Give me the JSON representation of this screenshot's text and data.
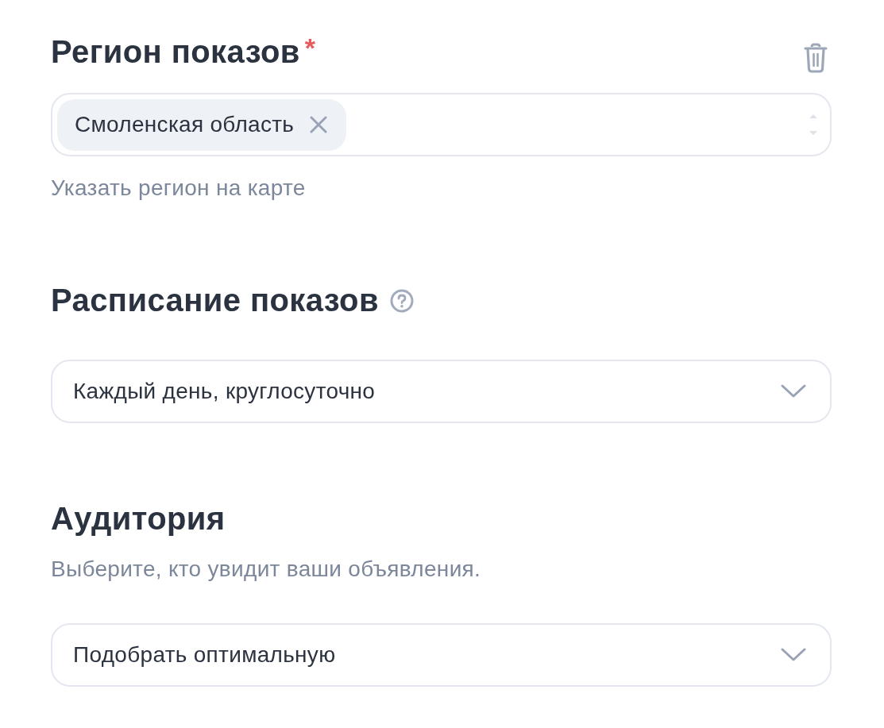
{
  "region": {
    "title": "Регион показов",
    "required_mark": "*",
    "deletable": true,
    "tags": [
      {
        "label": "Смоленская область"
      }
    ],
    "map_link": "Указать регион на карте"
  },
  "schedule": {
    "title": "Расписание показов",
    "help": true,
    "select": {
      "value": "Каждый день, круглосуточно"
    }
  },
  "audience": {
    "title": "Аудитория",
    "description": "Выберите, кто увидит ваши объявления.",
    "select": {
      "value": "Подобрать оптимальную"
    }
  }
}
